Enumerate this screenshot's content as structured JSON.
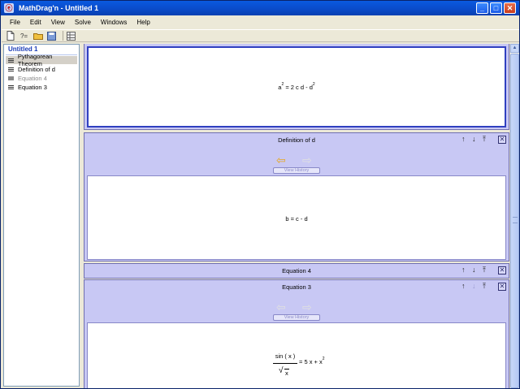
{
  "window": {
    "title": "MathDrag'n - Untitled 1",
    "icon_glyph": "ⓔ",
    "minimize": "_",
    "maximize": "□",
    "close": "✕"
  },
  "menu": [
    {
      "label": "File"
    },
    {
      "label": "Edit"
    },
    {
      "label": "View"
    },
    {
      "label": "Solve"
    },
    {
      "label": "Windows"
    },
    {
      "label": "Help"
    }
  ],
  "toolbar": {
    "icons": [
      "new-document-icon",
      "formula-icon",
      "open-folder-icon",
      "save-icon",
      "grid-icon"
    ],
    "formula_glyph": "?="
  },
  "sidebar": {
    "title": "Untitled 1",
    "items": [
      {
        "label": "Pythagorean Theorem",
        "selected": true
      },
      {
        "label": "Definition of d",
        "selected": false
      },
      {
        "label": "Equation 4",
        "dimmed": true
      },
      {
        "label": "Equation 3",
        "selected": false
      }
    ]
  },
  "panels": {
    "top_expr": {
      "base": "a",
      "sup1": "2",
      "rest": " = 2 c d - d",
      "sup2": "2"
    },
    "definition": {
      "title": "Definition of d",
      "history_label": "View History",
      "expr": "b = c - d"
    },
    "equation4": {
      "title": "Equation 4"
    },
    "equation3": {
      "title": "Equation 3",
      "history_label": "View History",
      "numerator": "sin ( x )",
      "denominator": "x",
      "rhs": "= 5 x + x",
      "rhs_sup": "2"
    },
    "controls": {
      "up": "↑",
      "down": "↓",
      "top": "⤒",
      "close": "✕"
    },
    "nav": {
      "back": "⇦",
      "forward": "⇨"
    }
  },
  "colors": {
    "panel_bg": "#c8c8f4",
    "title_bar": "#0a4ac8",
    "nav_active": "#e8a820"
  }
}
